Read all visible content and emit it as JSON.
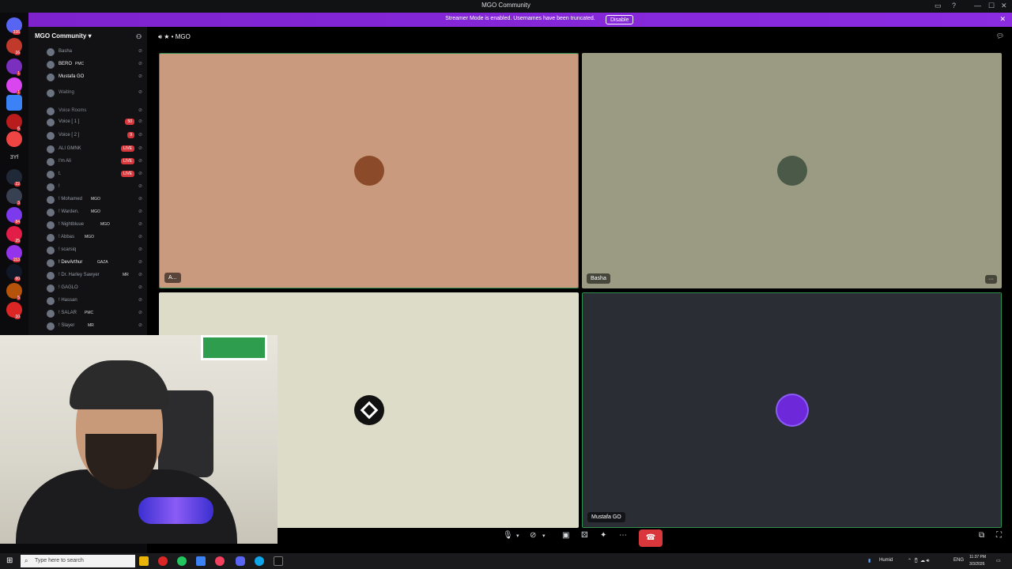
{
  "window": {
    "title": "MGO Community"
  },
  "banner": {
    "message": "Streamer Mode is enabled. Usernames have been truncated.",
    "disable_label": "Disable"
  },
  "server_badges": [
    "336",
    "16",
    "1",
    "1",
    "6",
    "3Yf",
    "22",
    "3",
    "84",
    "25",
    "153",
    "60",
    "5",
    "10"
  ],
  "channel_panel": {
    "server_name": "MGO Community",
    "rows": [
      {
        "name": "Basha",
        "tag": "",
        "color": "#949ba4"
      },
      {
        "name": "BERO",
        "tag": "PMC",
        "color": "#f2f3f5"
      },
      {
        "name": "Mustafa GO",
        "tag": "",
        "color": "#f2f3f5"
      },
      {
        "name": "Waiting",
        "tag": "",
        "color": "#80848e"
      },
      {
        "name": "Voice Rooms",
        "tag": "",
        "color": "#80848e"
      },
      {
        "name": "Voice [ 1 ]",
        "tag": "50",
        "color": "#949ba4"
      },
      {
        "name": "Voice [ 2 ]",
        "tag": "9",
        "color": "#949ba4"
      },
      {
        "name": "ALI GMNK",
        "tag": "LIVE",
        "color": "#949ba4"
      },
      {
        "name": "I'm Ali",
        "tag": "LIVE",
        "color": "#949ba4"
      },
      {
        "name": "t.",
        "tag": "LIVE",
        "color": "#949ba4"
      },
      {
        "name": "!",
        "tag": "",
        "color": "#949ba4"
      },
      {
        "name": "! Mohamed",
        "tag": "MGO",
        "color": "#949ba4"
      },
      {
        "name": "! Warden.",
        "tag": "MGO",
        "color": "#949ba4"
      },
      {
        "name": "! Nightbluue",
        "tag": "MGO",
        "color": "#949ba4"
      },
      {
        "name": "! Abbas",
        "tag": "MGO",
        "color": "#949ba4"
      },
      {
        "name": "! scarsiq",
        "tag": "",
        "color": "#949ba4"
      },
      {
        "name": "! DevArthur",
        "tag": "GAZA",
        "color": "#f2f3f5"
      },
      {
        "name": "! Dr. Harley Sawyer",
        "tag": "MR",
        "color": "#949ba4"
      },
      {
        "name": "! GAGLO",
        "tag": "",
        "color": "#949ba4"
      },
      {
        "name": "! Hassan",
        "tag": "",
        "color": "#949ba4"
      },
      {
        "name": "! SALAR",
        "tag": "PMC",
        "color": "#949ba4"
      },
      {
        "name": "! Slayer",
        "tag": "MR",
        "color": "#949ba4"
      }
    ]
  },
  "call": {
    "channel_title": "MGO",
    "tiles": [
      {
        "label": "A...",
        "bg": "#c99a7e"
      },
      {
        "label": "Basha",
        "bg": "#9b9b84"
      },
      {
        "label": "",
        "bg": "#dddcc8"
      },
      {
        "label": "Mustafa GO",
        "bg": "#2b2d34"
      }
    ],
    "more_label": "···"
  },
  "taskbar": {
    "search_placeholder": "Type here to search",
    "weather": "Humid",
    "language": "ENG",
    "time": "11:37 PM",
    "date": "3/3/2026"
  }
}
